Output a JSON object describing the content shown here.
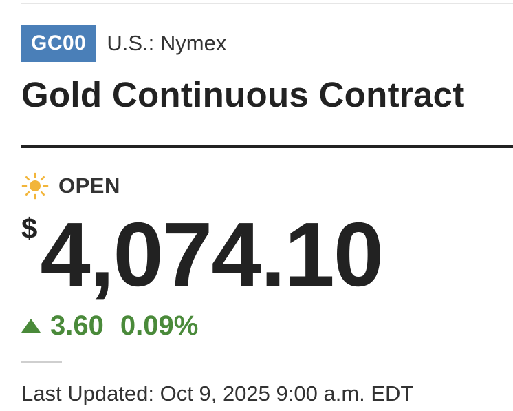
{
  "quote": {
    "ticker": "GC00",
    "exchange": "U.S.: Nymex",
    "name": "Gold Continuous Contract",
    "market_status": "OPEN",
    "market_status_icon": "sun-icon",
    "currency_symbol": "$",
    "price": "4,074.10",
    "change": "3.60",
    "change_percent": "0.09%",
    "change_direction_icon": "up-triangle-icon",
    "last_updated": "Last Updated: Oct 9, 2025 9:00 a.m. EDT"
  },
  "colors": {
    "badge": "#4a7fb8",
    "positive": "#4a8a3a",
    "sun": "#f2b53a",
    "text": "#222222"
  }
}
